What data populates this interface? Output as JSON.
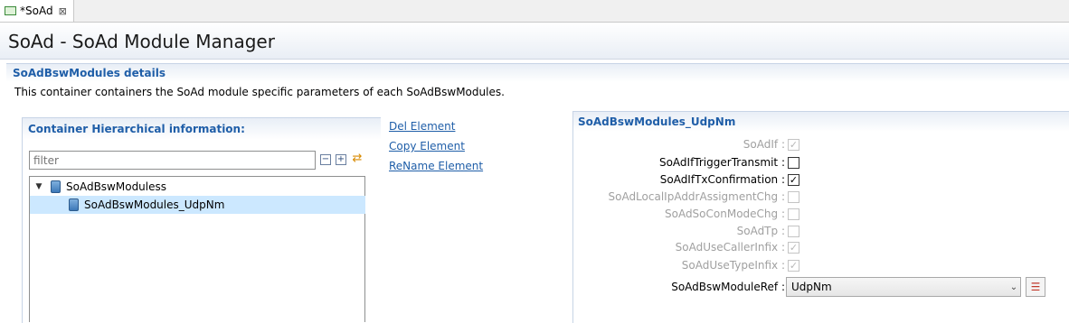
{
  "tab": {
    "label": "*SoAd",
    "close_glyph": "⊠"
  },
  "editor": {
    "title": "SoAd - SoAd Module Manager"
  },
  "section": {
    "title": "SoAdBswModules details",
    "description": "This container containers the SoAd module specific parameters of each SoAdBswModules."
  },
  "hierarchy": {
    "title": "Container Hierarchical information:",
    "filter_placeholder": "filter",
    "collapse_glyph": "−",
    "expand_glyph": "+",
    "tree": [
      {
        "label": "SoAdBswModuless",
        "expanded": true,
        "selected": false
      },
      {
        "label": "SoAdBswModules_UdpNm",
        "selected": true
      }
    ]
  },
  "actions": {
    "del": "Del Element",
    "copy": "Copy Element",
    "rename": "ReName Element"
  },
  "details": {
    "title": "SoAdBswModules_UdpNm",
    "params": [
      {
        "label": "SoAdIf :",
        "checked": true,
        "enabled": false
      },
      {
        "label": "SoAdIfTriggerTransmit :",
        "checked": false,
        "enabled": true
      },
      {
        "label": "SoAdIfTxConfirmation :",
        "checked": true,
        "enabled": true
      },
      {
        "label": "SoAdLocalIpAddrAssigmentChg :",
        "checked": false,
        "enabled": false
      },
      {
        "label": "SoAdSoConModeChg :",
        "checked": false,
        "enabled": false
      },
      {
        "label": "SoAdTp :",
        "checked": false,
        "enabled": false
      },
      {
        "label": "SoAdUseCallerInfix :",
        "checked": true,
        "enabled": false
      },
      {
        "label": "SoAdUseTypeInfix :",
        "checked": true,
        "enabled": false
      }
    ],
    "module_ref": {
      "label": "SoAdBswModuleRef :",
      "value": "UdpNm"
    }
  },
  "colors": {
    "link": "#1f5ea8",
    "selection": "#cce8ff",
    "disabled_text": "#a0a0a0"
  },
  "icons": {
    "tab": "file-icon",
    "sync": "sync-icon",
    "ref": "list-icon"
  }
}
